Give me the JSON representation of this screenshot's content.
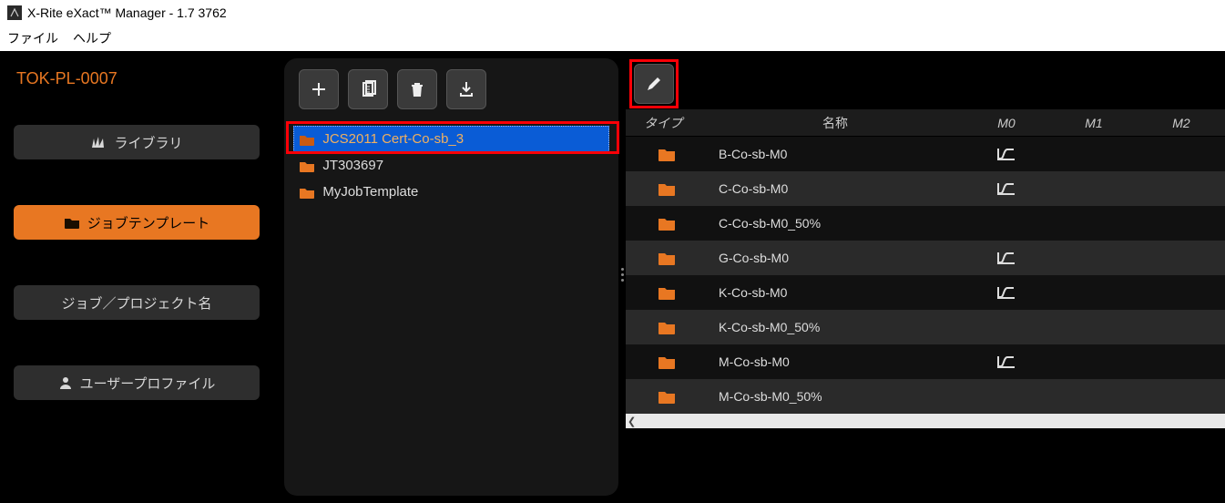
{
  "window": {
    "title": "X-Rite eXact™ Manager - 1.7  3762"
  },
  "menu": {
    "file": "ファイル",
    "help": "ヘルプ"
  },
  "device_id": "TOK-PL-0007",
  "sidebar": {
    "library": "ライブラリ",
    "job_template": "ジョブテンプレート",
    "job_project_name": "ジョブ／プロジェクト名",
    "user_profile": "ユーザープロファイル"
  },
  "toolbar_icons": {
    "add": "add-icon",
    "copy": "duplicate-icon",
    "delete": "trash-icon",
    "import": "download-icon",
    "edit": "pencil-icon"
  },
  "folders": [
    {
      "name": "JCS2011 Cert-Co-sb_3",
      "selected": true
    },
    {
      "name": "JT303697",
      "selected": false
    },
    {
      "name": "MyJobTemplate",
      "selected": false
    }
  ],
  "columns": {
    "type": "タイプ",
    "name": "名称",
    "m0": "M0",
    "m1": "M1",
    "m2": "M2"
  },
  "rows": [
    {
      "name": "B-Co-sb-M0",
      "m0": true
    },
    {
      "name": "C-Co-sb-M0",
      "m0": true
    },
    {
      "name": "C-Co-sb-M0_50%",
      "m0": false
    },
    {
      "name": "G-Co-sb-M0",
      "m0": true
    },
    {
      "name": "K-Co-sb-M0",
      "m0": true
    },
    {
      "name": "K-Co-sb-M0_50%",
      "m0": false
    },
    {
      "name": "M-Co-sb-M0",
      "m0": true
    },
    {
      "name": "M-Co-sb-M0_50%",
      "m0": false
    }
  ],
  "colors": {
    "accent": "#e87722",
    "highlight": "#fb0007",
    "select": "#0a5cd6"
  }
}
